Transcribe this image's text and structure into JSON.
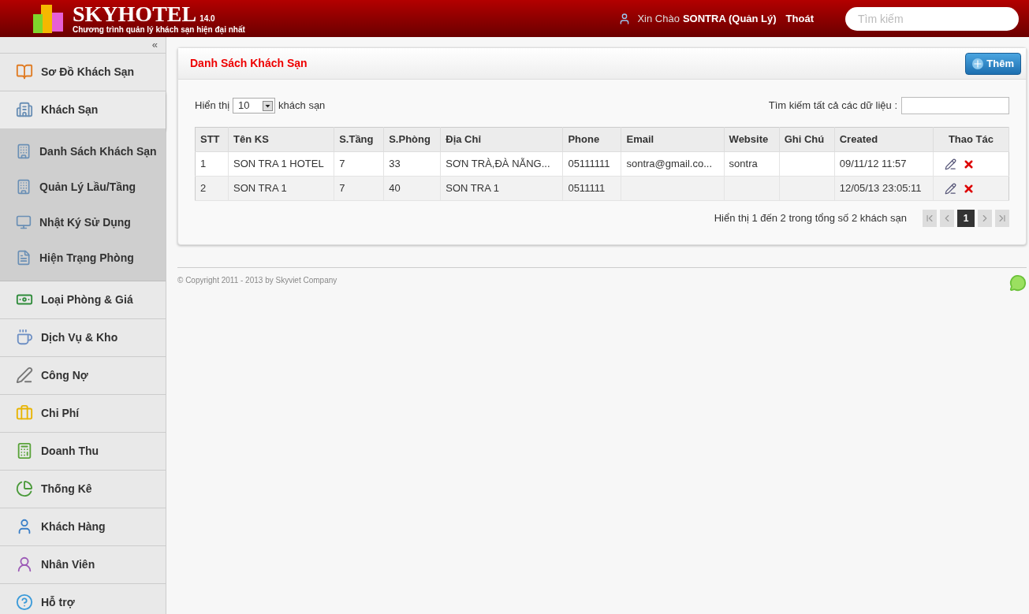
{
  "header": {
    "logo_title": "SKYHOTEL",
    "version": "14.0",
    "tagline": "Chương trình quản lý khách sạn hiện đại nhất",
    "greeting": "Xin Chào",
    "user": "SONTRA (Quản Lý)",
    "logout": "Thoát",
    "search": {
      "placeholder": "Tìm kiếm"
    }
  },
  "sidebar": {
    "collapse": "«",
    "items": [
      {
        "label": "Sơ Đồ Khách Sạn",
        "expanded": false
      },
      {
        "label": "Khách Sạn",
        "expanded": true,
        "children": [
          {
            "label": "Danh Sách Khách Sạn"
          },
          {
            "label": "Quản Lý Lầu/Tầng"
          },
          {
            "label": "Nhật Ký Sử Dụng"
          },
          {
            "label": "Hiện Trạng Phòng"
          }
        ]
      },
      {
        "label": "Loại Phòng & Giá",
        "expanded": false
      },
      {
        "label": "Dịch Vụ & Kho",
        "expanded": false
      },
      {
        "label": "Công Nợ",
        "expanded": false
      },
      {
        "label": "Chi Phí",
        "expanded": false
      },
      {
        "label": "Doanh Thu",
        "expanded": false
      },
      {
        "label": "Thống Kê",
        "expanded": false
      },
      {
        "label": "Khách Hàng",
        "expanded": false
      },
      {
        "label": "Nhân Viên",
        "expanded": false
      },
      {
        "label": "Hỗ trợ",
        "expanded": false
      }
    ]
  },
  "panel": {
    "title": "Danh Sách Khách Sạn",
    "add_button": "Thêm",
    "show_label": "Hiển thị",
    "page_size": "10",
    "show_suffix": "khách sạn",
    "search_label": "Tìm kiếm tất cả các dữ liệu :",
    "table": {
      "columns": [
        "STT",
        "Tên KS",
        "S.Tầng",
        "S.Phòng",
        "Địa Chỉ",
        "Phone",
        "Email",
        "Website",
        "Ghi Chú",
        "Created",
        "Thao Tác"
      ],
      "rows": [
        [
          "1",
          "SON TRA 1 HOTEL",
          "7",
          "33",
          "SƠN TRÀ,ĐÀ NẴNG...",
          "05111111",
          "sontra@gmail.co...",
          "sontra",
          "",
          "09/11/12 11:57"
        ],
        [
          "2",
          "SON TRA 1",
          "7",
          "40",
          "SON TRA 1",
          "0511111",
          "",
          "",
          "",
          "12/05/13 23:05:11"
        ]
      ]
    },
    "info": "Hiển thị 1 đến 2 trong tổng số 2 khách sạn",
    "pager": [
      {
        "kind": "first",
        "disabled": true
      },
      {
        "kind": "prev",
        "disabled": true
      },
      {
        "kind": "page",
        "label": "1",
        "selected": true
      },
      {
        "kind": "next",
        "disabled": true
      },
      {
        "kind": "last",
        "disabled": true
      }
    ]
  },
  "footer": {
    "copyright": "© Copyright 2011 - 2013 by Skyviet Company"
  }
}
